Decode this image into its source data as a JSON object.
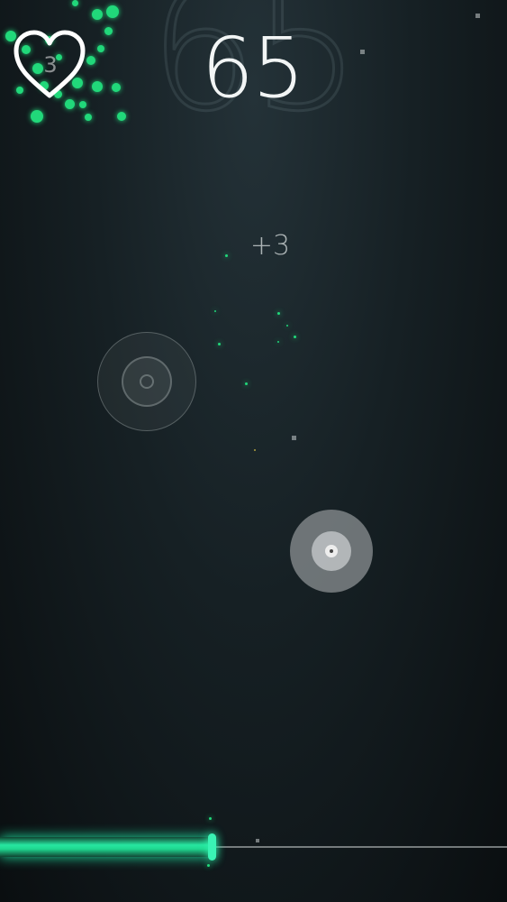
{
  "hud": {
    "score": "65",
    "score_bg": "65",
    "lives": "3",
    "combo_popup": "+3"
  },
  "progress": {
    "fraction": 0.42
  },
  "colors": {
    "accent_green": "#21d87a",
    "track_fill": "#27e6a0",
    "background": "#162024"
  },
  "icons": {
    "lives": "heart-icon",
    "target": "ring-target-icon"
  }
}
